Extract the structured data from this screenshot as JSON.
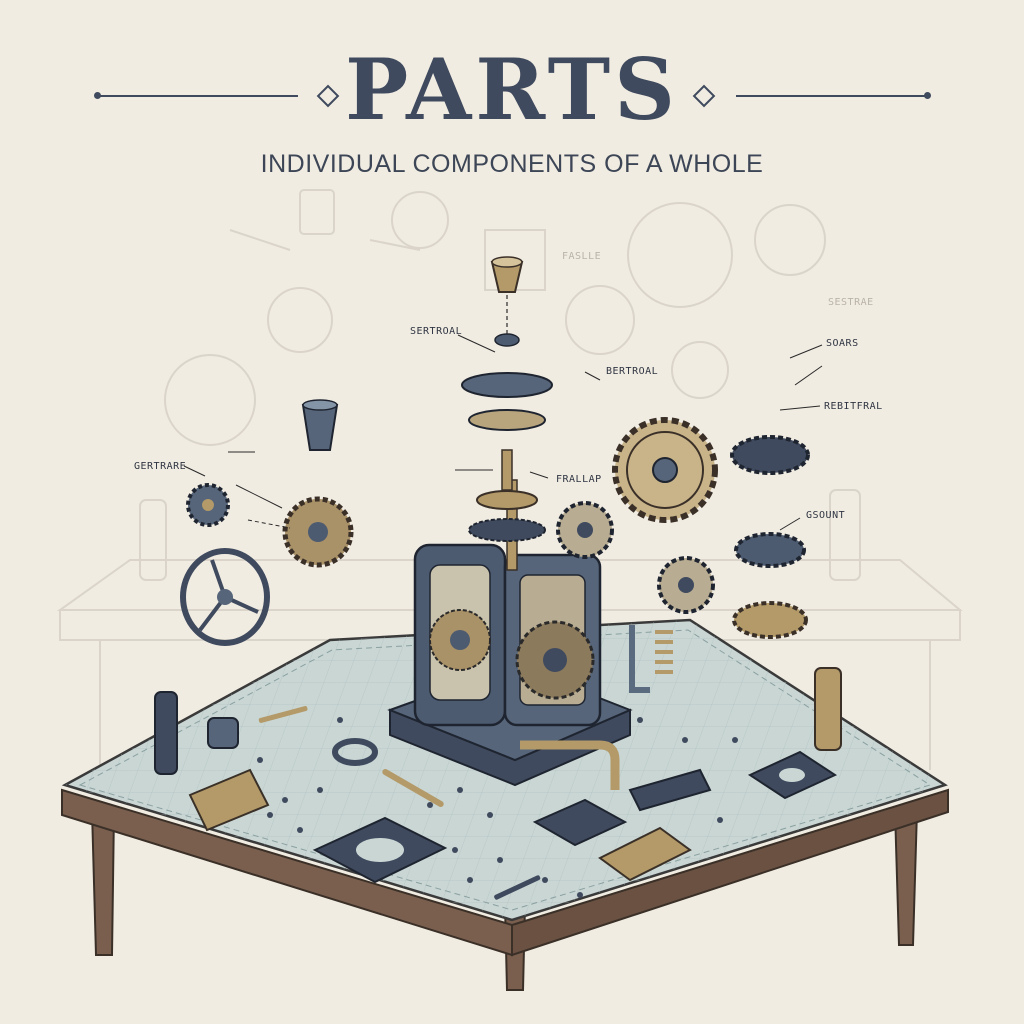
{
  "title": "PARTS",
  "subtitle": "INDIVIDUAL COMPONENTS OF A WHOLE",
  "callouts": {
    "sertroal": "SERTROAL",
    "bertroal": "BERTROAL",
    "gertrare": "GERTRARE",
    "frallap": "FRALLAP",
    "soars": "SOARS",
    "rebitfral": "REBITFRAL",
    "gsount": "GSOUNT",
    "faded_left": "FASLLE",
    "faded_right": "SESTRAE"
  },
  "colors": {
    "background": "#f1ece2",
    "ink": "#3f4a5e",
    "steel": "#5a6b80",
    "brass": "#b39a68",
    "table_top": "#c9d6d4",
    "table_wood": "#7a5f4e"
  },
  "icons": {
    "gear": "gear-icon",
    "handwheel": "handwheel-icon",
    "spring": "spring-icon",
    "bolt": "bolt-icon",
    "pipe": "pipe-icon",
    "plate": "mounting-plate-icon"
  }
}
